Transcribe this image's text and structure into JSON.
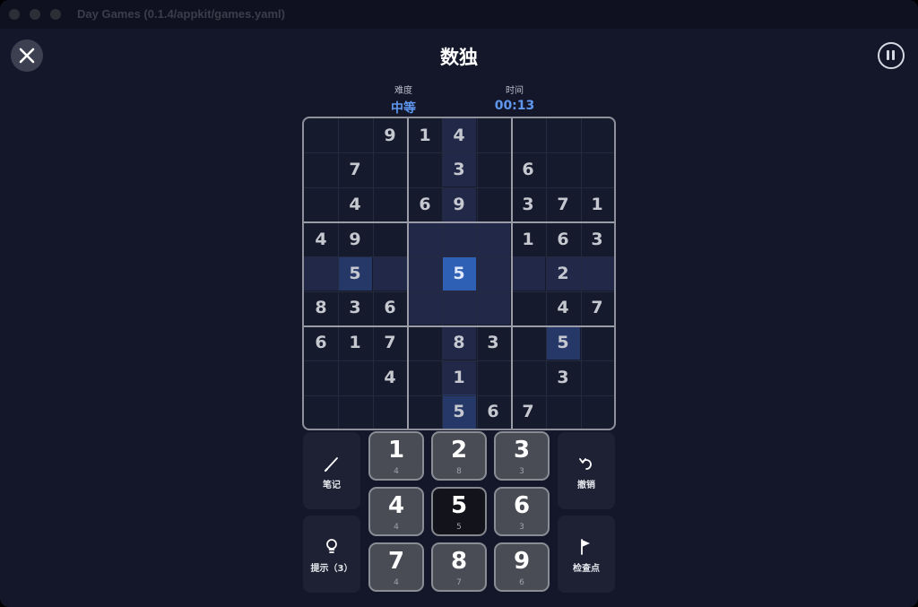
{
  "window": {
    "title": "Day Games (0.1.4/appkit/games.yaml)"
  },
  "header": {
    "title": "数独"
  },
  "stats": {
    "difficulty_label": "难度",
    "difficulty_value": "中等",
    "time_label": "时间",
    "time_value": "00:13"
  },
  "board": {
    "cells": [
      [
        "",
        "",
        "9",
        "1",
        "4",
        "",
        "",
        "",
        ""
      ],
      [
        "",
        "7",
        "",
        "",
        "3",
        "",
        "6",
        "",
        ""
      ],
      [
        "",
        "4",
        "",
        "6",
        "9",
        "",
        "3",
        "7",
        "1"
      ],
      [
        "4",
        "9",
        "",
        "",
        "",
        "",
        "1",
        "6",
        "3"
      ],
      [
        "",
        "5",
        "",
        "",
        "5",
        "",
        "",
        "2",
        ""
      ],
      [
        "8",
        "3",
        "6",
        "",
        "",
        "",
        "",
        "4",
        "7"
      ],
      [
        "6",
        "1",
        "7",
        "",
        "8",
        "3",
        "",
        "5",
        ""
      ],
      [
        "",
        "",
        "4",
        "",
        "1",
        "",
        "",
        "3",
        ""
      ],
      [
        "",
        "",
        "",
        "",
        "5",
        "6",
        "7",
        "",
        ""
      ]
    ],
    "selected": {
      "row": 4,
      "col": 4
    }
  },
  "controls": {
    "notes_label": "笔记",
    "hint_label": "提示（3）",
    "undo_label": "撤销",
    "check_label": "检查点"
  },
  "numpad": [
    {
      "number": "1",
      "count": "4"
    },
    {
      "number": "2",
      "count": "8"
    },
    {
      "number": "3",
      "count": "3"
    },
    {
      "number": "4",
      "count": "4"
    },
    {
      "number": "5",
      "count": "5"
    },
    {
      "number": "6",
      "count": "3"
    },
    {
      "number": "7",
      "count": "4"
    },
    {
      "number": "8",
      "count": "7"
    },
    {
      "number": "9",
      "count": "6"
    }
  ],
  "icons": {
    "close": "close-icon",
    "pause": "pause-icon",
    "notes": "pencil-icon",
    "hint": "lightbulb-icon",
    "undo": "undo-icon",
    "check": "flag-icon"
  },
  "colors": {
    "accent": "#5f97ee",
    "selected": "#2e60b5",
    "background": "#141729"
  }
}
